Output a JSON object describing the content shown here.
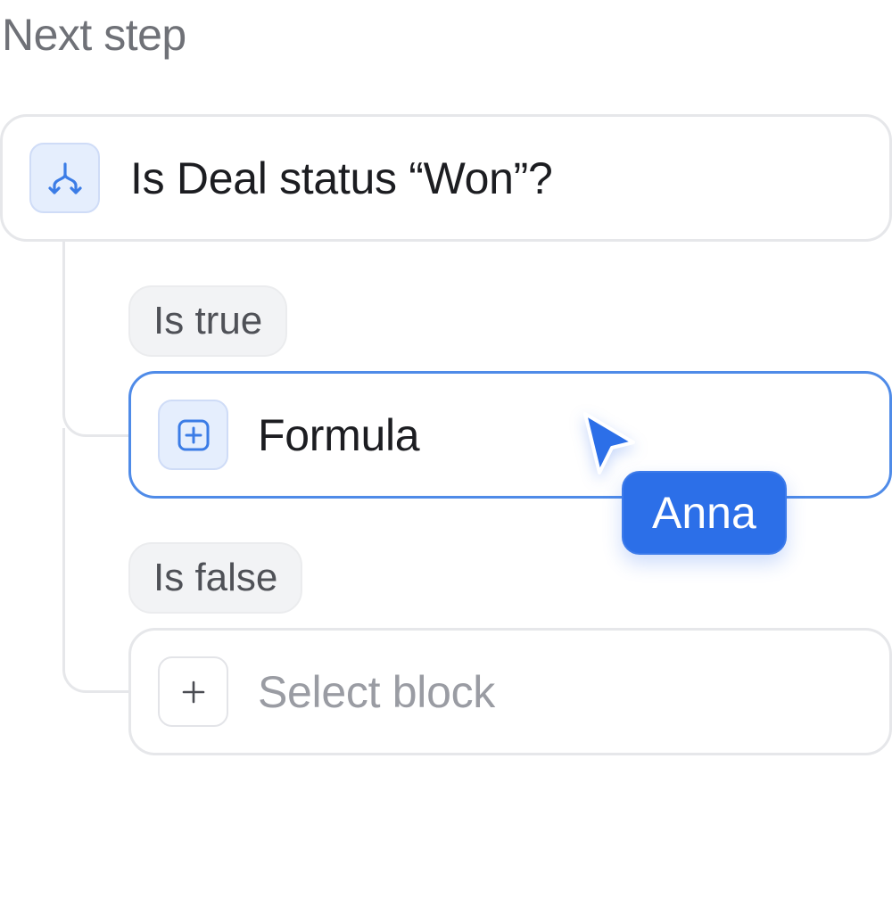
{
  "header": {
    "title": "Next step"
  },
  "condition": {
    "icon": "branch-icon",
    "label": "Is Deal status “Won”?"
  },
  "branches": {
    "true_label": "Is true",
    "false_label": "Is false"
  },
  "formula_block": {
    "icon": "plus-square-icon",
    "label": "Formula"
  },
  "select_block": {
    "icon": "plus-icon",
    "label": "Select block"
  },
  "collaborator": {
    "name": "Anna"
  },
  "colors": {
    "accent": "#2c6fe8",
    "selected_border": "#4f8be8",
    "card_border": "#e6e7ea",
    "heading_text": "#6f7177",
    "placeholder_text": "#9a9ca3"
  }
}
